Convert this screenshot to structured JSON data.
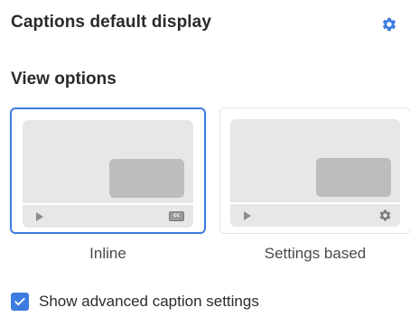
{
  "header": {
    "title": "Captions default display",
    "settings_icon": "gear-icon",
    "accent_color": "#3d7ce0"
  },
  "view_options": {
    "title": "View options",
    "options": [
      {
        "label": "Inline",
        "selected": true,
        "corner_icon": "closed-captions-icon"
      },
      {
        "label": "Settings based",
        "selected": false,
        "corner_icon": "gear-icon"
      }
    ],
    "cc_text": "cc"
  },
  "advanced": {
    "label": "Show advanced caption settings",
    "checked": true
  }
}
